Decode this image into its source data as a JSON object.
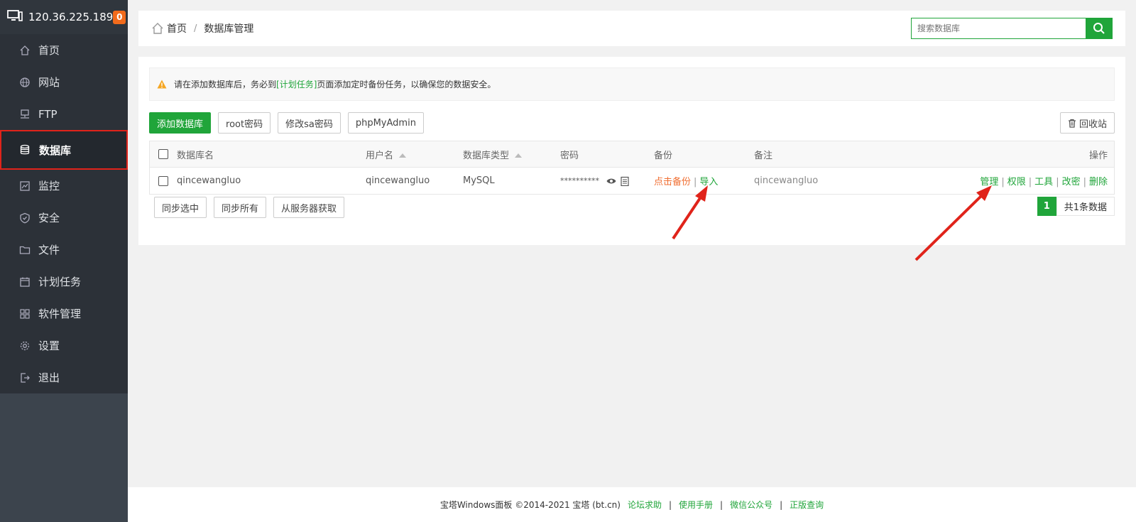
{
  "sidebar": {
    "ip": "120.36.225.189",
    "badge": "0",
    "items": [
      {
        "label": "首页",
        "icon": "home-icon"
      },
      {
        "label": "网站",
        "icon": "globe-icon"
      },
      {
        "label": "FTP",
        "icon": "ftp-icon"
      },
      {
        "label": "数据库",
        "icon": "database-icon",
        "active": true
      },
      {
        "label": "监控",
        "icon": "monitor-icon"
      },
      {
        "label": "安全",
        "icon": "shield-icon"
      },
      {
        "label": "文件",
        "icon": "folder-icon"
      },
      {
        "label": "计划任务",
        "icon": "calendar-icon"
      },
      {
        "label": "软件管理",
        "icon": "apps-icon"
      },
      {
        "label": "设置",
        "icon": "gear-icon"
      },
      {
        "label": "退出",
        "icon": "logout-icon"
      }
    ]
  },
  "breadcrumb": {
    "home": "首页",
    "sep": "/",
    "current": "数据库管理"
  },
  "search": {
    "placeholder": "搜索数据库"
  },
  "notice": {
    "before": "请在添加数据库后，务必到",
    "link": "[计划任务]",
    "after": "页面添加定时备份任务，以确保您的数据安全。"
  },
  "toolbar": {
    "add": "添加数据库",
    "root_pw": "root密码",
    "sa_pw": "修改sa密码",
    "phpmyadmin": "phpMyAdmin",
    "recycle": "回收站"
  },
  "table": {
    "headers": {
      "name": "数据库名",
      "user": "用户名",
      "type": "数据库类型",
      "password": "密码",
      "backup": "备份",
      "note": "备注",
      "ops": "操作"
    },
    "rows": [
      {
        "name": "qincewangluo",
        "user": "qincewangluo",
        "type": "MySQL",
        "password": "**********",
        "backup_link": "点击备份",
        "import_link": "导入",
        "note": "qincewangluo",
        "ops": [
          "管理",
          "权限",
          "工具",
          "改密",
          "删除"
        ]
      }
    ]
  },
  "bottom": {
    "sync_selected": "同步选中",
    "sync_all": "同步所有",
    "fetch": "从服务器获取"
  },
  "pager": {
    "page": "1",
    "total": "共1条数据"
  },
  "footer": {
    "copyright": "宝塔Windows面板 ©2014-2021 宝塔 (bt.cn)",
    "links": [
      "论坛求助",
      "使用手册",
      "微信公众号",
      "正版查询"
    ],
    "sep": "|"
  },
  "colors": {
    "accent": "#20a53a",
    "warning": "#f06e31",
    "highlight": "#e0231a"
  }
}
